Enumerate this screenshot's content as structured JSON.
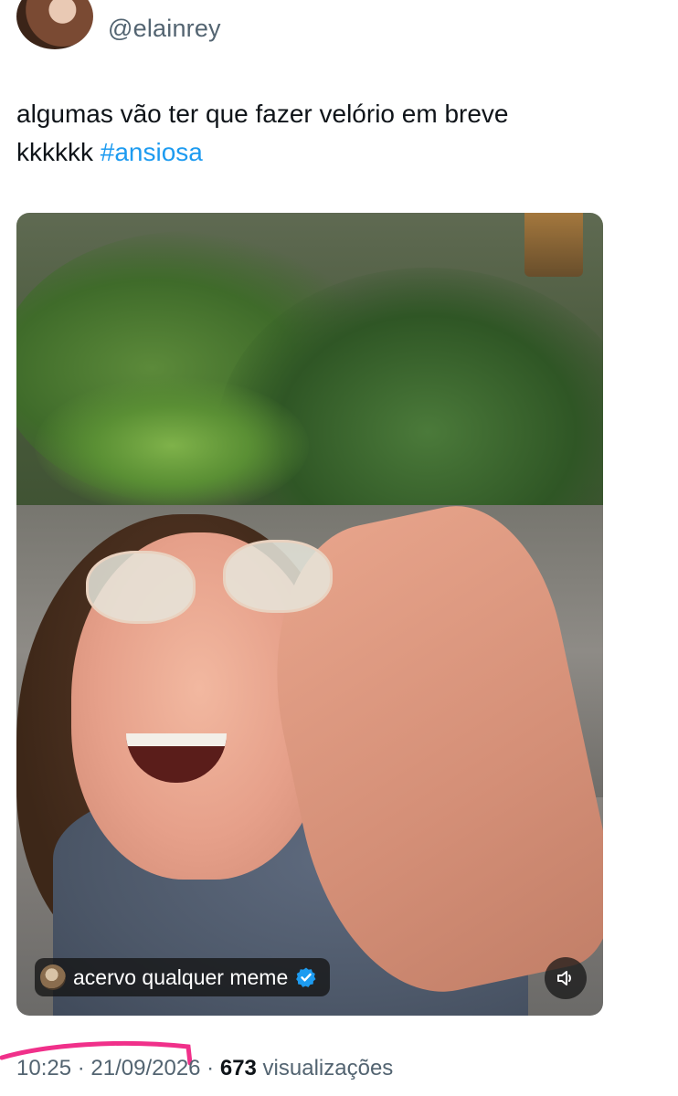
{
  "author": {
    "handle": "@elainrey"
  },
  "tweet": {
    "text_line1": "algumas vão ter que fazer velório em breve",
    "text_line2": "kkkkkk ",
    "hashtag": "#ansiosa"
  },
  "media": {
    "channel_name": "acervo qualquer meme",
    "sound_icon": "speaker-icon"
  },
  "meta": {
    "time": "10:25",
    "separator": " · ",
    "date": "21/09/2026",
    "views_count": "673",
    "views_label": " visualizações"
  },
  "colors": {
    "link": "#1d9bf0",
    "secondary_text": "#536471",
    "verified_badge": "#1d9bf0",
    "annotation_stroke": "#f0308a"
  }
}
